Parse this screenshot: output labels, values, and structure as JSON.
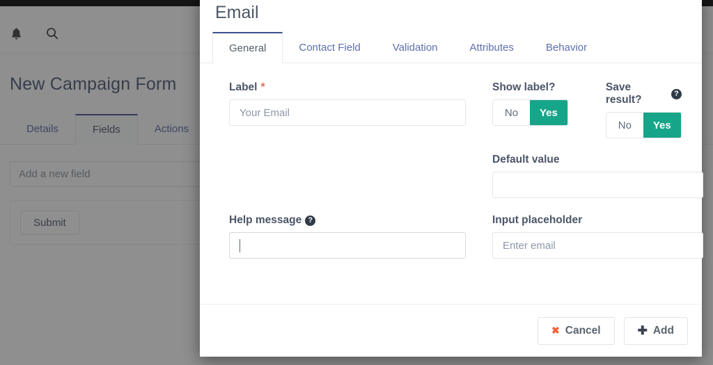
{
  "background": {
    "page_title": "New Campaign Form",
    "header_icons": [
      {
        "name": "bell-icon",
        "glyph": "•"
      },
      {
        "name": "search-icon",
        "glyph": "•"
      }
    ],
    "tabs": [
      {
        "label": "Details",
        "active": false
      },
      {
        "label": "Fields",
        "active": true
      },
      {
        "label": "Actions",
        "active": false
      }
    ],
    "add_field_placeholder": "Add a new field",
    "submit_label": "Submit"
  },
  "modal": {
    "title": "Email",
    "tabs": [
      {
        "label": "General",
        "active": true
      },
      {
        "label": "Contact Field",
        "active": false
      },
      {
        "label": "Validation",
        "active": false
      },
      {
        "label": "Attributes",
        "active": false
      },
      {
        "label": "Behavior",
        "active": false
      }
    ],
    "fields": {
      "label": {
        "title": "Label",
        "required_marker": "*",
        "value": "Your Email"
      },
      "show_label": {
        "title": "Show label?",
        "options": [
          "No",
          "Yes"
        ],
        "selected": "Yes"
      },
      "save_result": {
        "title": "Save result?",
        "help_glyph": "?",
        "options": [
          "No",
          "Yes"
        ],
        "selected": "Yes"
      },
      "default_value": {
        "title": "Default value",
        "value": ""
      },
      "help_message": {
        "title": "Help message",
        "help_glyph": "?",
        "value": "",
        "focused": true
      },
      "input_placeholder": {
        "title": "Input placeholder",
        "placeholder": "Enter email",
        "value": "Enter email"
      }
    },
    "footer": {
      "cancel_label": "Cancel",
      "cancel_glyph": "✖",
      "add_label": "Add",
      "add_glyph": "✚"
    }
  },
  "colors": {
    "accent_green": "#17a589",
    "tab_active_border": "#3d4f8f",
    "required_red": "#ef6c4d",
    "cancel_x": "#f0643c"
  }
}
